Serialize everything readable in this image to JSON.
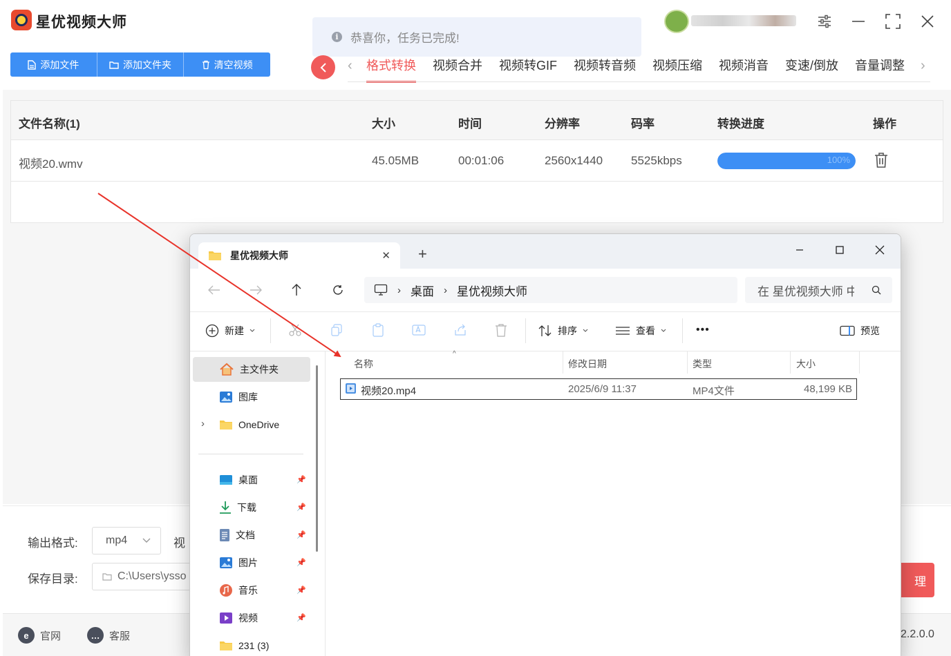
{
  "app": {
    "title": "星优视频大师",
    "toolbar": {
      "add_file": "添加文件",
      "add_folder": "添加文件夹",
      "clear_videos": "清空视频"
    },
    "toast": "恭喜你，任务已完成!",
    "tabs": [
      "格式转换",
      "视频合并",
      "视频转GIF",
      "视频转音频",
      "视频压缩",
      "视频消音",
      "变速/倒放",
      "音量调整"
    ],
    "active_tab": "格式转换",
    "table": {
      "headers": [
        "文件名称(1)",
        "大小",
        "时间",
        "分辨率",
        "码率",
        "转换进度",
        "操作"
      ],
      "rows": [
        {
          "name": "视频20.wmv",
          "size": "45.05MB",
          "duration": "00:01:06",
          "resolution": "2560x1440",
          "bitrate": "5525kbps",
          "progress_label": "100%",
          "progress": 1.0
        }
      ]
    },
    "output_format_label": "输出格式:",
    "output_format_value": "mp4",
    "video_label_partial": "视",
    "save_dir_label": "保存目录:",
    "save_dir_value": "C:\\Users\\ysso",
    "start_button_partial": "理",
    "footer": {
      "website": "官网",
      "support": "客服",
      "version": "2.2.0.0"
    },
    "colors": {
      "accent_blue": "#3d8ff5",
      "accent_red": "#f05a5a"
    }
  },
  "explorer": {
    "tab_title": "星优视频大师",
    "breadcrumb": [
      "桌面",
      "星优视频大师"
    ],
    "search_placeholder": "在 星优视频大师 中",
    "commands": {
      "new": "新建",
      "sort": "排序",
      "view": "查看",
      "more": "•••",
      "preview": "预览"
    },
    "nav": {
      "home": "主文件夹",
      "gallery": "图库",
      "onedrive": "OneDrive",
      "desktop": "桌面",
      "downloads": "下载",
      "documents": "文档",
      "pictures": "图片",
      "music": "音乐",
      "videos": "视频",
      "folder_231": "231 (3)"
    },
    "columns": [
      "名称",
      "修改日期",
      "类型",
      "大小"
    ],
    "files": [
      {
        "name": "视频20.mp4",
        "modified": "2025/6/9 11:37",
        "type": "MP4文件",
        "size": "48,199 KB"
      }
    ]
  }
}
